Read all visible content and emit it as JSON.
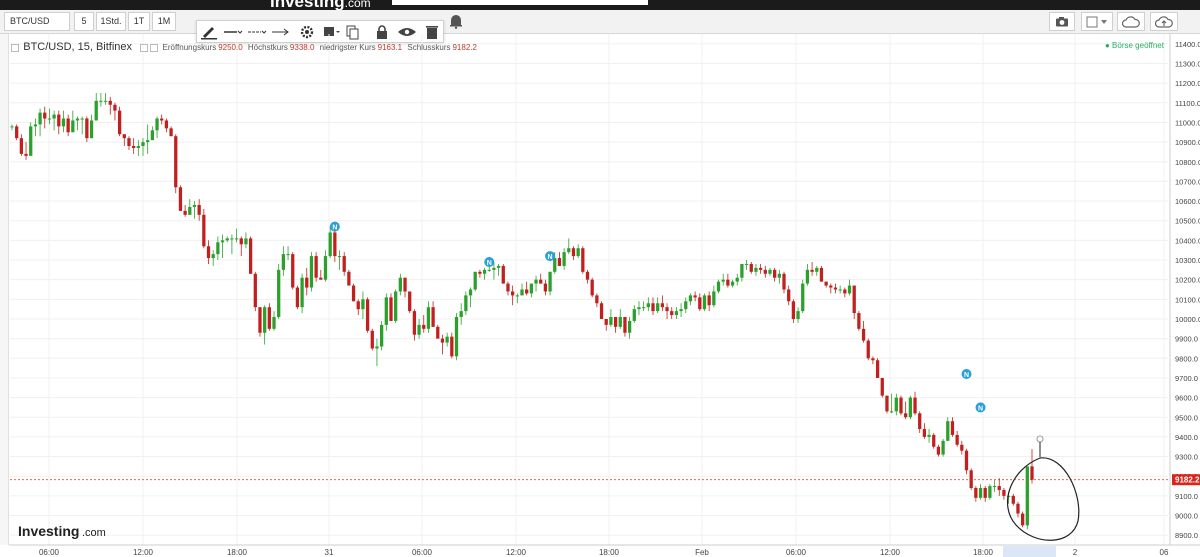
{
  "site": {
    "brand": "Investing",
    "brand_suffix": ".com"
  },
  "toolbar": {
    "symbol": "BTC/USD",
    "intervals": [
      "5",
      "1Std.",
      "1T",
      "1M"
    ]
  },
  "legend": {
    "instrument": "BTC/USD, 15, Bitfinex",
    "open_label": "Eröffnungskurs",
    "open": "9250.0",
    "high_label": "Höchstkurs",
    "high": "9338.0",
    "low_label": "niedrigster Kurs",
    "low": "9163.1",
    "close_label": "Schlusskurs",
    "close": "9182.2"
  },
  "status": {
    "text": "● Börse geöffnet",
    "color": "#27ae60"
  },
  "colors": {
    "up": "#2ca02c",
    "down": "#c0201e",
    "last_price": "#e74c3c",
    "news_marker": "#2a9fd8"
  },
  "chart_data": {
    "type": "candlestick",
    "ylim": [
      8850,
      11450
    ],
    "yticks": [
      8900,
      9000,
      9100,
      9200,
      9300,
      9400,
      9500,
      9600,
      9700,
      9800,
      9900,
      10000,
      10100,
      10200,
      10300,
      10400,
      10500,
      10600,
      10700,
      10800,
      10900,
      11000,
      11100,
      11200,
      11300,
      11400
    ],
    "ytick_labels": [
      "8900.0",
      "9000.0",
      "9100.0",
      "9200.0",
      "9300.0",
      "9400.0",
      "9500.0",
      "9600.0",
      "9700.0",
      "9800.0",
      "9900.0",
      "10000.0",
      "10100.0",
      "10200.0",
      "10300.0",
      "10400.0",
      "10500.0",
      "10600.0",
      "10700.0",
      "10800.0",
      "10900.0",
      "11000.0",
      "11100.0",
      "11200.0",
      "11300.0",
      "11400.0"
    ],
    "xticks": [
      "06:00",
      "12:00",
      "18:00",
      "31",
      "06:00",
      "12:00",
      "18:00",
      "Feb",
      "06:00",
      "12:00",
      "18:00",
      "2",
      "06"
    ],
    "last_price": 9182.2,
    "last_price_label": "9182.2",
    "news_marker_label": "N",
    "news_markers": [
      {
        "index": 69,
        "price": 10470
      },
      {
        "index": 102,
        "price": 10290
      },
      {
        "index": 115,
        "price": 10320
      },
      {
        "index": 204,
        "price": 9720
      },
      {
        "index": 207,
        "price": 9550
      }
    ],
    "ohlc": [
      [
        10980,
        10990,
        10960,
        10980
      ],
      [
        10980,
        10990,
        10910,
        10920
      ],
      [
        10920,
        10940,
        10830,
        10840
      ],
      [
        10840,
        10900,
        10810,
        10830
      ],
      [
        10830,
        11000,
        10830,
        10980
      ],
      [
        10980,
        11020,
        10930,
        10990
      ],
      [
        10990,
        11070,
        10930,
        11050
      ],
      [
        11050,
        11080,
        10970,
        11020
      ],
      [
        11020,
        11070,
        10990,
        11020
      ],
      [
        11020,
        11060,
        10960,
        11040
      ],
      [
        11040,
        11060,
        10940,
        10980
      ],
      [
        10980,
        11060,
        10950,
        11020
      ],
      [
        11020,
        11040,
        10930,
        10950
      ],
      [
        10950,
        11060,
        10950,
        11010
      ],
      [
        11010,
        11030,
        10960,
        11020
      ],
      [
        11020,
        11030,
        10940,
        11020
      ],
      [
        11020,
        11030,
        10900,
        10920
      ],
      [
        10920,
        11040,
        10920,
        11010
      ],
      [
        11010,
        11150,
        11010,
        11110
      ],
      [
        11110,
        11150,
        11080,
        11110
      ],
      [
        11110,
        11150,
        11090,
        11110
      ],
      [
        11110,
        11130,
        11040,
        11090
      ],
      [
        11090,
        11100,
        11010,
        11060
      ],
      [
        11060,
        11080,
        10930,
        10940
      ],
      [
        10940,
        10940,
        10880,
        10920
      ],
      [
        10920,
        10930,
        10860,
        10880
      ],
      [
        10880,
        10920,
        10840,
        10870
      ],
      [
        10870,
        10910,
        10830,
        10880
      ],
      [
        10880,
        10920,
        10830,
        10900
      ],
      [
        10900,
        10990,
        10840,
        10910
      ],
      [
        10910,
        10980,
        10910,
        10960
      ],
      [
        10960,
        11030,
        10920,
        11020
      ],
      [
        11020,
        11040,
        10990,
        11010
      ],
      [
        11010,
        11020,
        10950,
        10970
      ],
      [
        10970,
        10980,
        10930,
        10930
      ],
      [
        10930,
        10940,
        10640,
        10670
      ],
      [
        10670,
        10680,
        10550,
        10550
      ],
      [
        10550,
        10580,
        10520,
        10530
      ],
      [
        10530,
        10610,
        10530,
        10570
      ],
      [
        10570,
        10600,
        10510,
        10580
      ],
      [
        10580,
        10610,
        10500,
        10530
      ],
      [
        10530,
        10560,
        10360,
        10370
      ],
      [
        10370,
        10400,
        10280,
        10310
      ],
      [
        10310,
        10350,
        10270,
        10330
      ],
      [
        10330,
        10420,
        10300,
        10390
      ],
      [
        10390,
        10430,
        10310,
        10400
      ],
      [
        10400,
        10420,
        10390,
        10410
      ],
      [
        10410,
        10430,
        10330,
        10410
      ],
      [
        10410,
        10460,
        10390,
        10410
      ],
      [
        10410,
        10420,
        10320,
        10380
      ],
      [
        10380,
        10440,
        10360,
        10410
      ],
      [
        10410,
        10420,
        10230,
        10230
      ],
      [
        10230,
        10240,
        10040,
        10060
      ],
      [
        10060,
        10060,
        9910,
        9930
      ],
      [
        9930,
        10070,
        9870,
        10060
      ],
      [
        10060,
        10080,
        9940,
        9950
      ],
      [
        9950,
        10040,
        9940,
        10010
      ],
      [
        10010,
        10280,
        10000,
        10250
      ],
      [
        10250,
        10370,
        10220,
        10330
      ],
      [
        10330,
        10370,
        10300,
        10330
      ],
      [
        10330,
        10340,
        10150,
        10160
      ],
      [
        10160,
        10170,
        10050,
        10060
      ],
      [
        10060,
        10230,
        10030,
        10210
      ],
      [
        10210,
        10260,
        10120,
        10160
      ],
      [
        10160,
        10340,
        10140,
        10320
      ],
      [
        10320,
        10340,
        10190,
        10210
      ],
      [
        10210,
        10250,
        10200,
        10200
      ],
      [
        10200,
        10350,
        10190,
        10320
      ],
      [
        10320,
        10470,
        10310,
        10440
      ],
      [
        10440,
        10460,
        10290,
        10320
      ],
      [
        10320,
        10350,
        10250,
        10320
      ],
      [
        10320,
        10340,
        10220,
        10240
      ],
      [
        10240,
        10250,
        10170,
        10170
      ],
      [
        10170,
        10180,
        10090,
        10090
      ],
      [
        10090,
        10100,
        10020,
        10050
      ],
      [
        10050,
        10140,
        10000,
        10100
      ],
      [
        10100,
        10110,
        9930,
        9940
      ],
      [
        9940,
        9950,
        9840,
        9850
      ],
      [
        9850,
        9900,
        9760,
        9860
      ],
      [
        9860,
        9990,
        9840,
        9970
      ],
      [
        9970,
        10130,
        9940,
        10110
      ],
      [
        10110,
        10130,
        9990,
        9990
      ],
      [
        9990,
        10150,
        9980,
        10140
      ],
      [
        10140,
        10230,
        10120,
        10210
      ],
      [
        10210,
        10210,
        10110,
        10140
      ],
      [
        10140,
        10140,
        10030,
        10040
      ],
      [
        10040,
        10050,
        9890,
        9920
      ],
      [
        9920,
        10000,
        9900,
        9970
      ],
      [
        9970,
        10020,
        9930,
        9950
      ],
      [
        9950,
        10090,
        9930,
        10060
      ],
      [
        10060,
        10090,
        9960,
        9960
      ],
      [
        9960,
        9970,
        9900,
        9900
      ],
      [
        9900,
        9920,
        9820,
        9880
      ],
      [
        9880,
        9930,
        9860,
        9910
      ],
      [
        9910,
        9930,
        9800,
        9810
      ],
      [
        9810,
        10030,
        9790,
        10010
      ],
      [
        10010,
        10080,
        9970,
        10040
      ],
      [
        10040,
        10140,
        10020,
        10120
      ],
      [
        10120,
        10160,
        10060,
        10150
      ],
      [
        10150,
        10240,
        10140,
        10240
      ],
      [
        10240,
        10250,
        10210,
        10230
      ],
      [
        10230,
        10260,
        10200,
        10250
      ],
      [
        10250,
        10280,
        10240,
        10250
      ],
      [
        10250,
        10290,
        10200,
        10260
      ],
      [
        10260,
        10280,
        10220,
        10270
      ],
      [
        10270,
        10280,
        10180,
        10180
      ],
      [
        10180,
        10190,
        10120,
        10140
      ],
      [
        10140,
        10170,
        10070,
        10120
      ],
      [
        10120,
        10130,
        10080,
        10120
      ],
      [
        10120,
        10180,
        10120,
        10150
      ],
      [
        10150,
        10190,
        10120,
        10130
      ],
      [
        10130,
        10180,
        10110,
        10180
      ],
      [
        10180,
        10220,
        10140,
        10200
      ],
      [
        10200,
        10230,
        10180,
        10180
      ],
      [
        10180,
        10200,
        10120,
        10140
      ],
      [
        10140,
        10240,
        10120,
        10240
      ],
      [
        10240,
        10340,
        10230,
        10310
      ],
      [
        10310,
        10340,
        10270,
        10270
      ],
      [
        10270,
        10360,
        10250,
        10340
      ],
      [
        10340,
        10410,
        10330,
        10360
      ],
      [
        10360,
        10370,
        10300,
        10320
      ],
      [
        10320,
        10380,
        10310,
        10360
      ],
      [
        10360,
        10370,
        10230,
        10240
      ],
      [
        10240,
        10250,
        10180,
        10200
      ],
      [
        10200,
        10210,
        10110,
        10120
      ],
      [
        10120,
        10130,
        10060,
        10080
      ],
      [
        10080,
        10090,
        10000,
        10000
      ],
      [
        10000,
        10000,
        9940,
        9970
      ],
      [
        9970,
        10050,
        9960,
        10010
      ],
      [
        10010,
        10010,
        9930,
        9960
      ],
      [
        9960,
        10050,
        9950,
        10010
      ],
      [
        10010,
        10010,
        9910,
        9930
      ],
      [
        9930,
        10010,
        9900,
        9990
      ],
      [
        9990,
        10070,
        9980,
        10050
      ],
      [
        10050,
        10090,
        10020,
        10060
      ],
      [
        10060,
        10090,
        10040,
        10060
      ],
      [
        10060,
        10110,
        10040,
        10080
      ],
      [
        10080,
        10110,
        10020,
        10040
      ],
      [
        10040,
        10110,
        10030,
        10080
      ],
      [
        10080,
        10120,
        10040,
        10060
      ],
      [
        10060,
        10080,
        10000,
        10040
      ],
      [
        10040,
        10060,
        10000,
        10020
      ],
      [
        10020,
        10060,
        10000,
        10040
      ],
      [
        10040,
        10080,
        10010,
        10050
      ],
      [
        10050,
        10110,
        10030,
        10090
      ],
      [
        10090,
        10130,
        10070,
        10120
      ],
      [
        10120,
        10140,
        10090,
        10110
      ],
      [
        10110,
        10130,
        10040,
        10050
      ],
      [
        10050,
        10130,
        10040,
        10120
      ],
      [
        10120,
        10140,
        10040,
        10070
      ],
      [
        10070,
        10170,
        10060,
        10140
      ],
      [
        10140,
        10200,
        10130,
        10190
      ],
      [
        10190,
        10230,
        10170,
        10200
      ],
      [
        10200,
        10230,
        10160,
        10170
      ],
      [
        10170,
        10200,
        10160,
        10190
      ],
      [
        10190,
        10230,
        10170,
        10210
      ],
      [
        10210,
        10280,
        10190,
        10280
      ],
      [
        10280,
        10300,
        10250,
        10280
      ],
      [
        10280,
        10290,
        10230,
        10240
      ],
      [
        10240,
        10280,
        10220,
        10260
      ],
      [
        10260,
        10280,
        10230,
        10250
      ],
      [
        10250,
        10270,
        10210,
        10230
      ],
      [
        10230,
        10260,
        10220,
        10250
      ],
      [
        10250,
        10260,
        10190,
        10210
      ],
      [
        10210,
        10250,
        10180,
        10230
      ],
      [
        10230,
        10240,
        10130,
        10150
      ],
      [
        10150,
        10170,
        10070,
        10090
      ],
      [
        10090,
        10100,
        9980,
        10000
      ],
      [
        10000,
        10060,
        9980,
        10040
      ],
      [
        10040,
        10200,
        10030,
        10180
      ],
      [
        10180,
        10280,
        10170,
        10250
      ],
      [
        10250,
        10290,
        10220,
        10240
      ],
      [
        10240,
        10270,
        10220,
        10260
      ],
      [
        10260,
        10270,
        10190,
        10190
      ],
      [
        10190,
        10190,
        10160,
        10170
      ],
      [
        10170,
        10180,
        10130,
        10160
      ],
      [
        10160,
        10180,
        10130,
        10150
      ],
      [
        10150,
        10170,
        10130,
        10150
      ],
      [
        10150,
        10160,
        10110,
        10130
      ],
      [
        10130,
        10200,
        10120,
        10170
      ],
      [
        10170,
        10170,
        10000,
        10030
      ],
      [
        10030,
        10040,
        9940,
        9950
      ],
      [
        9950,
        9990,
        9880,
        9890
      ],
      [
        9890,
        9900,
        9790,
        9800
      ],
      [
        9800,
        9810,
        9770,
        9790
      ],
      [
        9790,
        9800,
        9700,
        9700
      ],
      [
        9700,
        9700,
        9600,
        9610
      ],
      [
        9610,
        9610,
        9520,
        9530
      ],
      [
        9530,
        9620,
        9520,
        9530
      ],
      [
        9530,
        9620,
        9510,
        9600
      ],
      [
        9600,
        9610,
        9510,
        9520
      ],
      [
        9520,
        9580,
        9490,
        9500
      ],
      [
        9500,
        9610,
        9490,
        9600
      ],
      [
        9600,
        9630,
        9510,
        9520
      ],
      [
        9520,
        9530,
        9420,
        9440
      ],
      [
        9440,
        9470,
        9390,
        9400
      ],
      [
        9400,
        9440,
        9370,
        9410
      ],
      [
        9410,
        9420,
        9340,
        9350
      ],
      [
        9350,
        9360,
        9300,
        9310
      ],
      [
        9310,
        9390,
        9300,
        9380
      ],
      [
        9380,
        9500,
        9380,
        9480
      ],
      [
        9480,
        9500,
        9400,
        9410
      ],
      [
        9410,
        9430,
        9350,
        9360
      ],
      [
        9360,
        9380,
        9310,
        9330
      ],
      [
        9330,
        9340,
        9210,
        9230
      ],
      [
        9230,
        9240,
        9130,
        9140
      ],
      [
        9140,
        9150,
        9070,
        9090
      ],
      [
        9090,
        9160,
        9080,
        9140
      ],
      [
        9140,
        9150,
        9070,
        9090
      ],
      [
        9090,
        9160,
        9080,
        9150
      ],
      [
        9150,
        9180,
        9120,
        9150
      ],
      [
        9150,
        9190,
        9100,
        9130
      ],
      [
        9130,
        9140,
        9080,
        9100
      ],
      [
        9100,
        9120,
        9060,
        9100
      ],
      [
        9100,
        9110,
        9050,
        9060
      ],
      [
        9060,
        9070,
        8990,
        9010
      ],
      [
        9010,
        9020,
        8940,
        8950
      ],
      [
        8950,
        9250,
        8930,
        9250
      ],
      [
        9250,
        9338,
        9163.1,
        9182.2
      ]
    ],
    "title": "BTC/USD, 15, Bitfinex"
  }
}
